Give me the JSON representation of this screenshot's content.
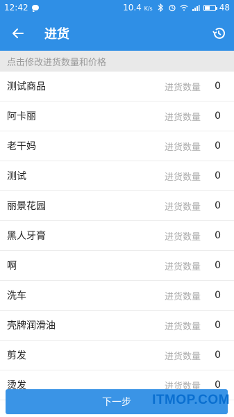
{
  "status_bar": {
    "time": "12:42",
    "net_speed": "10.4",
    "net_unit": "K/s",
    "battery": "48"
  },
  "header": {
    "title": "进货",
    "back_icon": "back-arrow-icon",
    "history_icon": "history-icon"
  },
  "hint": "点击修改进货数量和价格",
  "items": [
    {
      "name": "测试商品",
      "label": "进货数量",
      "qty": "0"
    },
    {
      "name": "阿卡丽",
      "label": "进货数量",
      "qty": "0"
    },
    {
      "name": "老干妈",
      "label": "进货数量",
      "qty": "0"
    },
    {
      "name": "测试",
      "label": "进货数量",
      "qty": "0"
    },
    {
      "name": "丽景花园",
      "label": "进货数量",
      "qty": "0"
    },
    {
      "name": "黑人牙膏",
      "label": "进货数量",
      "qty": "0"
    },
    {
      "name": "啊",
      "label": "进货数量",
      "qty": "0"
    },
    {
      "name": "洗车",
      "label": "进货数量",
      "qty": "0"
    },
    {
      "name": "壳牌润滑油",
      "label": "进货数量",
      "qty": "0"
    },
    {
      "name": "剪发",
      "label": "进货数量",
      "qty": "0"
    },
    {
      "name": "烫发",
      "label": "进货数量",
      "qty": "0"
    }
  ],
  "footer": {
    "next_label": "下一步",
    "watermark": "ITMOP.COM"
  },
  "colors": {
    "primary": "#2f8fe6",
    "button": "#3a94e6"
  }
}
